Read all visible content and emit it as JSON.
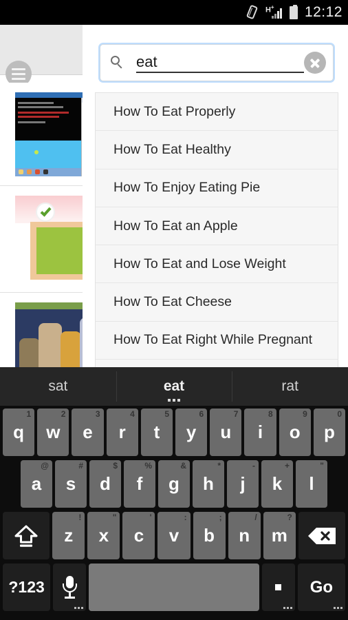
{
  "status_bar": {
    "time": "12:12",
    "icons": [
      "vibrate-icon",
      "signal-hplus-icon",
      "battery-icon"
    ],
    "signal_label": "H",
    "signal_sup": "+"
  },
  "app": {
    "menu_button": "hamburger-menu",
    "cards": [
      {
        "thumb": "desktop-screenshot"
      },
      {
        "thumb": "books-illustration"
      },
      {
        "thumb": "crowd-photo"
      }
    ]
  },
  "search": {
    "query": "eat",
    "placeholder": "Search",
    "clear_label": "",
    "suggestions": [
      "How To Eat Properly",
      "How To Eat Healthy",
      "How To Enjoy Eating Pie",
      "How To Eat an Apple",
      "How To Eat and Lose Weight",
      "How To Eat Cheese",
      "How To Eat Right While Pregnant"
    ]
  },
  "keyboard": {
    "suggestions": [
      {
        "word": "sat",
        "active": false
      },
      {
        "word": "eat",
        "active": true
      },
      {
        "word": "rat",
        "active": false
      }
    ],
    "row1": [
      {
        "key": "q",
        "alt": "1"
      },
      {
        "key": "w",
        "alt": "2"
      },
      {
        "key": "e",
        "alt": "3"
      },
      {
        "key": "r",
        "alt": "4"
      },
      {
        "key": "t",
        "alt": "5"
      },
      {
        "key": "y",
        "alt": "6"
      },
      {
        "key": "u",
        "alt": "7"
      },
      {
        "key": "i",
        "alt": "8"
      },
      {
        "key": "o",
        "alt": "9"
      },
      {
        "key": "p",
        "alt": "0"
      }
    ],
    "row2": [
      {
        "key": "a",
        "alt": "@"
      },
      {
        "key": "s",
        "alt": "#"
      },
      {
        "key": "d",
        "alt": "$"
      },
      {
        "key": "f",
        "alt": "%"
      },
      {
        "key": "g",
        "alt": "&"
      },
      {
        "key": "h",
        "alt": "*"
      },
      {
        "key": "j",
        "alt": "-"
      },
      {
        "key": "k",
        "alt": "+"
      },
      {
        "key": "l",
        "alt": "\""
      }
    ],
    "row3": [
      {
        "key": "z",
        "alt": "!"
      },
      {
        "key": "x",
        "alt": "\""
      },
      {
        "key": "c",
        "alt": "'"
      },
      {
        "key": "v",
        "alt": ":"
      },
      {
        "key": "b",
        "alt": ";"
      },
      {
        "key": "n",
        "alt": "/"
      },
      {
        "key": "m",
        "alt": "?"
      }
    ],
    "shift_label": "shift-icon",
    "backspace_label": "backspace-icon",
    "symbols_label": "?123",
    "mic_label": "microphone-icon",
    "space_label": "",
    "period_label": ".",
    "enter_label": "Go"
  },
  "colors": {
    "accent_focus": "#6eb4fa",
    "keyboard_bg": "#0d0d0d",
    "key_bg": "#6b6b6b",
    "suggestion_bg": "#f6f6f6"
  }
}
